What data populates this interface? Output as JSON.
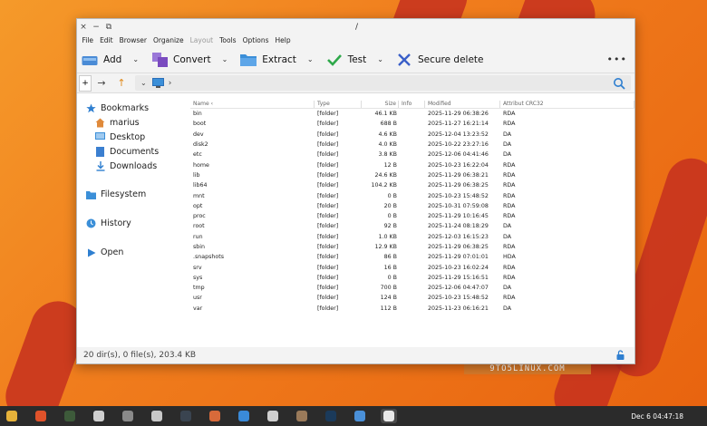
{
  "window": {
    "title": "/",
    "controls": [
      "×",
      "−",
      "⧉"
    ]
  },
  "menus": [
    {
      "label": "File",
      "enabled": true
    },
    {
      "label": "Edit",
      "enabled": true
    },
    {
      "label": "Browser",
      "enabled": true
    },
    {
      "label": "Organize",
      "enabled": true
    },
    {
      "label": "Layout",
      "enabled": false
    },
    {
      "label": "Tools",
      "enabled": true
    },
    {
      "label": "Options",
      "enabled": true
    },
    {
      "label": "Help",
      "enabled": true
    }
  ],
  "toolbar": [
    {
      "label": "Add",
      "icon": "drive-icon",
      "name": "add",
      "color": "#4a8bd6"
    },
    {
      "label": "Convert",
      "icon": "convert-icon",
      "name": "convert",
      "color": "#7a4bbf"
    },
    {
      "label": "Extract",
      "icon": "folder-icon",
      "name": "extract",
      "color": "#3b8fd8"
    },
    {
      "label": "Test",
      "icon": "check-icon",
      "name": "test",
      "color": "#2ea84a"
    },
    {
      "label": "Secure delete",
      "icon": "x-icon",
      "name": "secure-delete",
      "color": "#3a5fc8"
    }
  ],
  "address": {
    "new_tab": "+",
    "back": "→",
    "up": "↑",
    "chevron": "⌄",
    "separator": "›"
  },
  "sidebar": {
    "bookmarks": {
      "label": "Bookmarks",
      "items": [
        {
          "label": "marius",
          "icon": "home-icon"
        },
        {
          "label": "Desktop",
          "icon": "desktop-icon"
        },
        {
          "label": "Documents",
          "icon": "documents-icon"
        },
        {
          "label": "Downloads",
          "icon": "downloads-icon"
        }
      ]
    },
    "filesystem": "Filesystem",
    "history": "History",
    "open": "Open"
  },
  "columns": [
    "Name ‹",
    "Type",
    "Size",
    "Info",
    "Modified",
    "Attribut CRC32"
  ],
  "rows": [
    [
      "bin",
      "[folder]",
      "46.1 KB",
      "",
      "2025-11-29 06:38:26",
      "RDA"
    ],
    [
      "boot",
      "[folder]",
      "688 B",
      "",
      "2025-11-27 16:21:14",
      "RDA"
    ],
    [
      "dev",
      "[folder]",
      "4.6 KB",
      "",
      "2025-12-04 13:23:52",
      "DA"
    ],
    [
      "disk2",
      "[folder]",
      "4.0 KB",
      "",
      "2025-10-22 23:27:16",
      "DA"
    ],
    [
      "etc",
      "[folder]",
      "3.8 KB",
      "",
      "2025-12-06 04:41:46",
      "DA"
    ],
    [
      "home",
      "[folder]",
      "12 B",
      "",
      "2025-10-23 16:22:04",
      "RDA"
    ],
    [
      "lib",
      "[folder]",
      "24.6 KB",
      "",
      "2025-11-29 06:38:21",
      "RDA"
    ],
    [
      "lib64",
      "[folder]",
      "104.2 KB",
      "",
      "2025-11-29 06:38:25",
      "RDA"
    ],
    [
      "mnt",
      "[folder]",
      "0 B",
      "",
      "2025-10-23 15:48:52",
      "RDA"
    ],
    [
      "opt",
      "[folder]",
      "20 B",
      "",
      "2025-10-31 07:59:08",
      "RDA"
    ],
    [
      "proc",
      "[folder]",
      "0 B",
      "",
      "2025-11-29 10:16:45",
      "RDA"
    ],
    [
      "root",
      "[folder]",
      "92 B",
      "",
      "2025-11-24 08:18:29",
      "DA"
    ],
    [
      "run",
      "[folder]",
      "1.0 KB",
      "",
      "2025-12-03 16:15:23",
      "DA"
    ],
    [
      "sbin",
      "[folder]",
      "12.9 KB",
      "",
      "2025-11-29 06:38:25",
      "RDA"
    ],
    [
      ".snapshots",
      "[folder]",
      "86 B",
      "",
      "2025-11-29 07:01:01",
      "HDA"
    ],
    [
      "srv",
      "[folder]",
      "16 B",
      "",
      "2025-10-23 16:02:24",
      "RDA"
    ],
    [
      "sys",
      "[folder]",
      "0 B",
      "",
      "2025-11-29 15:16:51",
      "RDA"
    ],
    [
      "tmp",
      "[folder]",
      "700 B",
      "",
      "2025-12-06 04:47:07",
      "DA"
    ],
    [
      "usr",
      "[folder]",
      "124 B",
      "",
      "2025-10-23 15:48:52",
      "RDA"
    ],
    [
      "var",
      "[folder]",
      "112 B",
      "",
      "2025-11-23 06:16:21",
      "DA"
    ]
  ],
  "status": "20 dir(s), 0 file(s), 203.4 KB",
  "watermark": "9TO5LINUX.COM",
  "taskbar": {
    "apps": [
      {
        "name": "files",
        "color": "#e6b23a"
      },
      {
        "name": "firefox",
        "color": "#e0522a"
      },
      {
        "name": "game",
        "color": "#3d5a3a"
      },
      {
        "name": "document-viewer",
        "color": "#cfcfcf"
      },
      {
        "name": "settings",
        "color": "#8a8a8a"
      },
      {
        "name": "text-editor",
        "color": "#c8c8c8"
      },
      {
        "name": "terminal",
        "color": "#3a4450"
      },
      {
        "name": "screenshot",
        "color": "#d86a3a"
      },
      {
        "name": "monitor",
        "color": "#3a8ad8"
      },
      {
        "name": "store",
        "color": "#cfcfcf"
      },
      {
        "name": "gimp",
        "color": "#9a7a5a"
      },
      {
        "name": "steam",
        "color": "#1b3a5a"
      },
      {
        "name": "chrome",
        "color": "#4a90d8"
      },
      {
        "name": "archiver",
        "color": "#e8e8e8"
      }
    ],
    "clock": "Dec 6  04:47:18"
  },
  "colors": {
    "stripe": "#c6301f",
    "accent": "#2f7fd0"
  }
}
